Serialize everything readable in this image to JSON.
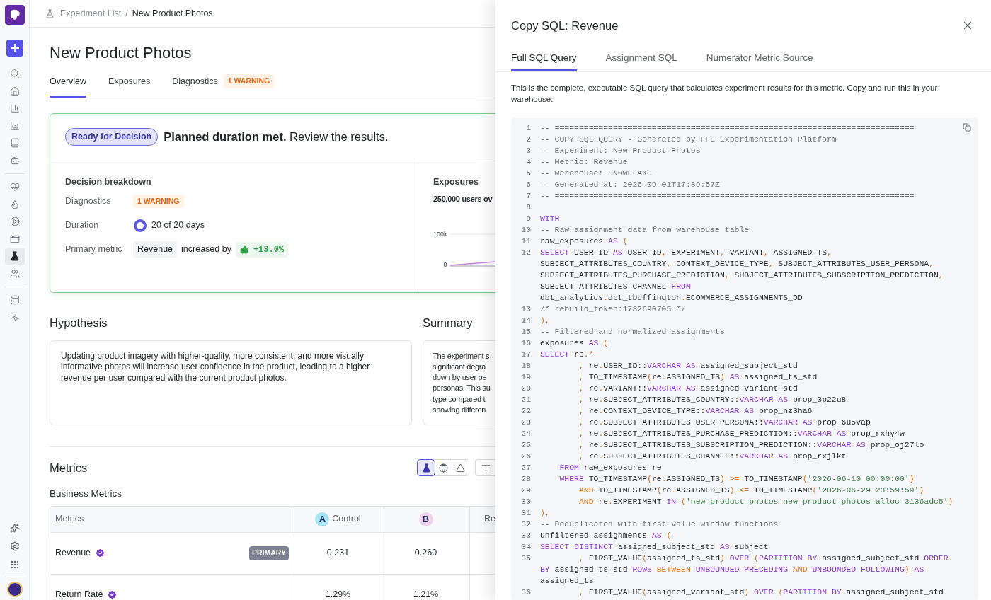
{
  "sidebar": {
    "items": [
      {
        "selected": false
      },
      {
        "selected": false
      },
      {
        "selected": false
      },
      {
        "selected": false
      },
      {
        "selected": false
      },
      {
        "selected": false
      },
      {
        "selected": false
      },
      {
        "selected": false
      },
      {
        "selected": false
      },
      {
        "selected": false
      },
      {
        "selected": true
      },
      {
        "selected": false
      },
      {
        "selected": false
      },
      {
        "selected": false
      }
    ]
  },
  "breadcrumb": {
    "items": [
      "Experiment List",
      "New Product Photos"
    ],
    "separator": "/"
  },
  "title": "New Product Photos",
  "tabs": [
    {
      "label": "Overview",
      "selected": true
    },
    {
      "label": "Exposures",
      "selected": false
    },
    {
      "label": "Diagnostics",
      "selected": false,
      "badge": "1 WARNING"
    }
  ],
  "status_card": {
    "badge": "Ready for Decision",
    "headline": "**Planned duration met.** Review the results.",
    "breakdown": {
      "title": "Decision breakdown",
      "rows": [
        {
          "kind": "badge",
          "label": "Diagnostics",
          "value": "1 WARNING"
        },
        {
          "kind": "progress",
          "label": "Duration",
          "value": "20 of 20 days",
          "level": 1
        },
        {
          "kind": "metric",
          "label": "Primary metric",
          "metric": "Revenue",
          "text": "increased by",
          "change": "+13.0%"
        }
      ]
    },
    "exposures": {
      "title": "Exposures",
      "summary": "250,000 users ov",
      "y_ticks": [
        "100k",
        "0"
      ]
    }
  },
  "hypothesis": {
    "title": "Hypothesis",
    "text": "Updating product imagery with higher-quality, more consistent, and more visually informative photos will increase user confidence in the product, leading to a higher revenue per user compared with the current product photos."
  },
  "summary": {
    "title": "Summary",
    "lines": [
      "The experiment s",
      "significant degra",
      "down by user pe",
      "personas. This su",
      "type compared t",
      "showing differen"
    ]
  },
  "metrics": {
    "title": "Metrics",
    "view_toggles": [
      {
        "selected": true
      },
      {
        "selected": false
      },
      {
        "selected": false
      }
    ],
    "section": "Business Metrics",
    "table": {
      "columns": [
        {
          "label": "Metrics"
        },
        {
          "variant": "A",
          "label": "Control",
          "color": "#a5e4f5"
        },
        {
          "variant": "B",
          "color": "#f3d3f1"
        },
        {
          "label": "Re"
        }
      ],
      "rows": [
        {
          "name": "Revenue",
          "verified": true,
          "badge": "PRIMARY",
          "values": [
            "0.231",
            "0.260"
          ]
        },
        {
          "name": "Return Rate",
          "verified": true,
          "values": [
            "1.29%",
            "1.21%"
          ]
        }
      ]
    }
  },
  "panel": {
    "title": "Copy SQL: Revenue",
    "tabs": [
      {
        "label": "Full SQL Query",
        "selected": true
      },
      {
        "label": "Assignment SQL",
        "selected": false
      },
      {
        "label": "Numerator Metric Source",
        "selected": false
      }
    ],
    "description": "This is the complete, executable SQL query that calculates experiment results for this metric. Copy and run this in your warehouse.",
    "code": [
      {
        "n": "1",
        "seg": [
          {
            "kind": "c",
            "text": "-- =========================================================================="
          }
        ]
      },
      {
        "n": "2",
        "seg": [
          {
            "kind": "c",
            "text": "-- COPY SQL QUERY - Generated by FFE Experimentation Platform"
          }
        ]
      },
      {
        "n": "3",
        "seg": [
          {
            "kind": "c",
            "text": "-- Experiment: New Product Photos"
          }
        ]
      },
      {
        "n": "4",
        "seg": [
          {
            "kind": "c",
            "text": "-- Metric: Revenue"
          }
        ]
      },
      {
        "n": "5",
        "seg": [
          {
            "kind": "c",
            "text": "-- Warehouse: SNOWFLAKE"
          }
        ]
      },
      {
        "n": "6",
        "seg": [
          {
            "kind": "c",
            "text": "-- Generated at: 2026-09-01T17:39:57Z"
          }
        ]
      },
      {
        "n": "7",
        "seg": [
          {
            "kind": "c",
            "text": "-- =========================================================================="
          }
        ]
      },
      {
        "n": "8"
      },
      {
        "n": "9",
        "seg": [
          {
            "kind": "k",
            "text": "WITH"
          }
        ]
      },
      {
        "n": "10",
        "seg": [
          {
            "kind": "c",
            "text": "-- Raw assignment data from warehouse table"
          }
        ]
      },
      {
        "n": "11",
        "seg": [
          {
            "kind": "t",
            "text": "raw_exposures "
          },
          {
            "kind": "k",
            "text": "AS"
          },
          {
            "kind": "p",
            "text": " ("
          }
        ]
      },
      {
        "n": "12",
        "seg": [
          {
            "kind": "k",
            "text": "SELECT"
          },
          {
            "kind": "t",
            "text": " USER_ID "
          },
          {
            "kind": "k",
            "text": "AS"
          },
          {
            "kind": "t",
            "text": " USER_ID"
          },
          {
            "kind": "p",
            "text": ","
          },
          {
            "kind": "t",
            "text": " EXPERIMENT"
          },
          {
            "kind": "p",
            "text": ","
          },
          {
            "kind": "t",
            "text": " VARIANT"
          },
          {
            "kind": "p",
            "text": ","
          },
          {
            "kind": "t",
            "text": " ASSIGNED_TS"
          },
          {
            "kind": "p",
            "text": ","
          },
          {
            "kind": "t",
            "text": " SUBJECT_ATTRIBUTES_COUNTRY"
          },
          {
            "kind": "p",
            "text": ","
          },
          {
            "kind": "t",
            "text": " CONTEXT_DEVICE_TYPE"
          },
          {
            "kind": "p",
            "text": ","
          },
          {
            "kind": "t",
            "text": " SUBJECT_ATTRIBUTES_USER_PERSONA"
          },
          {
            "kind": "p",
            "text": ","
          },
          {
            "kind": "t",
            "text": " SUBJECT_ATTRIBUTES_PURCHASE_PREDICTION"
          },
          {
            "kind": "p",
            "text": ","
          },
          {
            "kind": "t",
            "text": " SUBJECT_ATTRIBUTES_SUBSCRIPTION_PREDICTION"
          },
          {
            "kind": "p",
            "text": ","
          },
          {
            "kind": "t",
            "text": " SUBJECT_ATTRIBUTES_CHANNEL "
          },
          {
            "kind": "k",
            "text": "FROM"
          },
          {
            "kind": "t",
            "text": " dbt_analytics"
          },
          {
            "kind": "p",
            "text": "."
          },
          {
            "kind": "t",
            "text": "dbt_tbuffington"
          },
          {
            "kind": "p",
            "text": "."
          },
          {
            "kind": "t",
            "text": "ECOMMERCE_ASSIGNMENTS_DD"
          }
        ]
      },
      {
        "n": "13",
        "seg": [
          {
            "kind": "c",
            "text": "/* rebuild_token:1782690705 */"
          }
        ]
      },
      {
        "n": "14",
        "seg": [
          {
            "kind": "p",
            "text": "),"
          }
        ]
      },
      {
        "n": "15",
        "seg": [
          {
            "kind": "c",
            "text": "-- Filtered and normalized assignments"
          }
        ]
      },
      {
        "n": "16",
        "seg": [
          {
            "kind": "t",
            "text": "exposures "
          },
          {
            "kind": "k",
            "text": "AS"
          },
          {
            "kind": "p",
            "text": " ("
          }
        ]
      },
      {
        "n": "17",
        "seg": [
          {
            "kind": "k",
            "text": "SELECT"
          },
          {
            "kind": "t",
            "text": " re"
          },
          {
            "kind": "p",
            "text": ".*"
          }
        ]
      },
      {
        "n": "18",
        "seg": [
          {
            "kind": "p",
            "text": "        ,"
          },
          {
            "kind": "t",
            "text": " re"
          },
          {
            "kind": "p",
            "text": "."
          },
          {
            "kind": "t",
            "text": "USER_ID::"
          },
          {
            "kind": "k",
            "text": "VARCHAR"
          },
          {
            "kind": "k",
            "text": " AS"
          },
          {
            "kind": "t",
            "text": " assigned_subject_std"
          }
        ]
      },
      {
        "n": "19",
        "seg": [
          {
            "kind": "p",
            "text": "        ,"
          },
          {
            "kind": "t",
            "text": " TO_TIMESTAMP"
          },
          {
            "kind": "p",
            "text": "("
          },
          {
            "kind": "t",
            "text": "re"
          },
          {
            "kind": "p",
            "text": "."
          },
          {
            "kind": "t",
            "text": "ASSIGNED_TS"
          },
          {
            "kind": "p",
            "text": ")"
          },
          {
            "kind": "k",
            "text": " AS"
          },
          {
            "kind": "t",
            "text": " assigned_ts_std"
          }
        ]
      },
      {
        "n": "20",
        "seg": [
          {
            "kind": "p",
            "text": "        ,"
          },
          {
            "kind": "t",
            "text": " re"
          },
          {
            "kind": "p",
            "text": "."
          },
          {
            "kind": "t",
            "text": "VARIANT::"
          },
          {
            "kind": "k",
            "text": "VARCHAR"
          },
          {
            "kind": "k",
            "text": " AS"
          },
          {
            "kind": "t",
            "text": " assigned_variant_std"
          }
        ]
      },
      {
        "n": "21",
        "seg": [
          {
            "kind": "p",
            "text": "        ,"
          },
          {
            "kind": "t",
            "text": " re"
          },
          {
            "kind": "p",
            "text": "."
          },
          {
            "kind": "t",
            "text": "SUBJECT_ATTRIBUTES_COUNTRY::"
          },
          {
            "kind": "k",
            "text": "VARCHAR"
          },
          {
            "kind": "k",
            "text": " AS"
          },
          {
            "kind": "t",
            "text": " prop_3p22u8"
          }
        ]
      },
      {
        "n": "22",
        "seg": [
          {
            "kind": "p",
            "text": "        ,"
          },
          {
            "kind": "t",
            "text": " re"
          },
          {
            "kind": "p",
            "text": "."
          },
          {
            "kind": "t",
            "text": "CONTEXT_DEVICE_TYPE::"
          },
          {
            "kind": "k",
            "text": "VARCHAR"
          },
          {
            "kind": "k",
            "text": " AS"
          },
          {
            "kind": "t",
            "text": " prop_nz3ha6"
          }
        ]
      },
      {
        "n": "23",
        "seg": [
          {
            "kind": "p",
            "text": "        ,"
          },
          {
            "kind": "t",
            "text": " re"
          },
          {
            "kind": "p",
            "text": "."
          },
          {
            "kind": "t",
            "text": "SUBJECT_ATTRIBUTES_USER_PERSONA::"
          },
          {
            "kind": "k",
            "text": "VARCHAR"
          },
          {
            "kind": "k",
            "text": " AS"
          },
          {
            "kind": "t",
            "text": " prop_6u5vap"
          }
        ]
      },
      {
        "n": "24",
        "seg": [
          {
            "kind": "p",
            "text": "        ,"
          },
          {
            "kind": "t",
            "text": " re"
          },
          {
            "kind": "p",
            "text": "."
          },
          {
            "kind": "t",
            "text": "SUBJECT_ATTRIBUTES_PURCHASE_PREDICTION::"
          },
          {
            "kind": "k",
            "text": "VARCHAR"
          },
          {
            "kind": "k",
            "text": " AS"
          },
          {
            "kind": "t",
            "text": " prop_rxhy4w"
          }
        ]
      },
      {
        "n": "25",
        "seg": [
          {
            "kind": "p",
            "text": "        ,"
          },
          {
            "kind": "t",
            "text": " re"
          },
          {
            "kind": "p",
            "text": "."
          },
          {
            "kind": "t",
            "text": "SUBJECT_ATTRIBUTES_SUBSCRIPTION_PREDICTION::"
          },
          {
            "kind": "k",
            "text": "VARCHAR"
          },
          {
            "kind": "k",
            "text": " AS"
          },
          {
            "kind": "t",
            "text": " prop_oj27lo"
          }
        ]
      },
      {
        "n": "26",
        "seg": [
          {
            "kind": "p",
            "text": "        ,"
          },
          {
            "kind": "t",
            "text": " re"
          },
          {
            "kind": "p",
            "text": "."
          },
          {
            "kind": "t",
            "text": "SUBJECT_ATTRIBUTES_CHANNEL::"
          },
          {
            "kind": "k",
            "text": "VARCHAR"
          },
          {
            "kind": "k",
            "text": " AS"
          },
          {
            "kind": "t",
            "text": " prop_rxjlkt"
          }
        ]
      },
      {
        "n": "27",
        "seg": [
          {
            "kind": "k",
            "text": "    FROM"
          },
          {
            "kind": "t",
            "text": " raw_exposures re"
          }
        ]
      },
      {
        "n": "28",
        "seg": [
          {
            "kind": "k",
            "text": "    WHERE"
          },
          {
            "kind": "t",
            "text": " TO_TIMESTAMP"
          },
          {
            "kind": "p",
            "text": "("
          },
          {
            "kind": "t",
            "text": "re"
          },
          {
            "kind": "p",
            "text": "."
          },
          {
            "kind": "t",
            "text": "ASSIGNED_TS"
          },
          {
            "kind": "p",
            "text": ")"
          },
          {
            "kind": "p",
            "text": " >="
          },
          {
            "kind": "t",
            "text": " TO_TIMESTAMP"
          },
          {
            "kind": "p",
            "text": "("
          },
          {
            "kind": "s",
            "text": "'2026-06-10 00:00:00'"
          },
          {
            "kind": "p",
            "text": ")"
          }
        ]
      },
      {
        "n": "29",
        "seg": [
          {
            "kind": "p",
            "text": "        AND"
          },
          {
            "kind": "t",
            "text": " TO_TIMESTAMP"
          },
          {
            "kind": "p",
            "text": "("
          },
          {
            "kind": "t",
            "text": "re"
          },
          {
            "kind": "p",
            "text": "."
          },
          {
            "kind": "t",
            "text": "ASSIGNED_TS"
          },
          {
            "kind": "p",
            "text": ")"
          },
          {
            "kind": "p",
            "text": " <="
          },
          {
            "kind": "t",
            "text": " TO_TIMESTAMP"
          },
          {
            "kind": "p",
            "text": "("
          },
          {
            "kind": "s",
            "text": "'2026-06-29 23:59:59'"
          },
          {
            "kind": "p",
            "text": ")"
          }
        ]
      },
      {
        "n": "30",
        "seg": [
          {
            "kind": "p",
            "text": "        AND"
          },
          {
            "kind": "t",
            "text": " re"
          },
          {
            "kind": "p",
            "text": "."
          },
          {
            "kind": "t",
            "text": "EXPERIMENT "
          },
          {
            "kind": "k",
            "text": "IN"
          },
          {
            "kind": "p",
            "text": " ("
          },
          {
            "kind": "s",
            "text": "'new-product-photos-new-product-photos-alloc-3136adc5'"
          },
          {
            "kind": "p",
            "text": ")"
          }
        ]
      },
      {
        "n": "31",
        "seg": [
          {
            "kind": "p",
            "text": "),"
          }
        ]
      },
      {
        "n": "32",
        "seg": [
          {
            "kind": "c",
            "text": "-- Deduplicated with first value window functions"
          }
        ]
      },
      {
        "n": "33",
        "seg": [
          {
            "kind": "t",
            "text": "unfiltered_assignments "
          },
          {
            "kind": "k",
            "text": "AS"
          },
          {
            "kind": "p",
            "text": " ("
          }
        ]
      },
      {
        "n": "34",
        "seg": [
          {
            "kind": "k",
            "text": "SELECT"
          },
          {
            "kind": "k",
            "text": " DISTINCT"
          },
          {
            "kind": "t",
            "text": " assigned_subject_std "
          },
          {
            "kind": "k",
            "text": "AS"
          },
          {
            "kind": "t",
            "text": " subject"
          }
        ]
      },
      {
        "n": "35",
        "seg": [
          {
            "kind": "p",
            "text": "        ,"
          },
          {
            "kind": "t",
            "text": " FIRST_VALUE"
          },
          {
            "kind": "p",
            "text": "("
          },
          {
            "kind": "t",
            "text": "assigned_ts_std"
          },
          {
            "kind": "p",
            "text": ")"
          },
          {
            "kind": "k",
            "text": " OVER"
          },
          {
            "kind": "p",
            "text": " ("
          },
          {
            "kind": "k",
            "text": "PARTITION BY"
          },
          {
            "kind": "t",
            "text": " assigned_subject_std "
          },
          {
            "kind": "k",
            "text": "ORDER BY"
          },
          {
            "kind": "t",
            "text": " assigned_ts_std "
          },
          {
            "kind": "k",
            "text": "ROWS"
          },
          {
            "kind": "p",
            "text": " BETWEEN"
          },
          {
            "kind": "k",
            "text": " UNBOUNDED PRECEDING"
          },
          {
            "kind": "p",
            "text": " AND"
          },
          {
            "kind": "k",
            "text": " UNBOUNDED FOLLOWING"
          },
          {
            "kind": "p",
            "text": ")"
          },
          {
            "kind": "k",
            "text": " AS"
          },
          {
            "kind": "t",
            "text": " assigned_ts"
          }
        ]
      },
      {
        "n": "36",
        "seg": [
          {
            "kind": "p",
            "text": "        ,"
          },
          {
            "kind": "t",
            "text": " FIRST_VALUE"
          },
          {
            "kind": "p",
            "text": "("
          },
          {
            "kind": "t",
            "text": "assigned_variant_std"
          },
          {
            "kind": "p",
            "text": ")"
          },
          {
            "kind": "k",
            "text": " OVER"
          },
          {
            "kind": "p",
            "text": " ("
          },
          {
            "kind": "k",
            "text": "PARTITION BY"
          },
          {
            "kind": "t",
            "text": " assigned_subject_std"
          }
        ]
      }
    ]
  }
}
